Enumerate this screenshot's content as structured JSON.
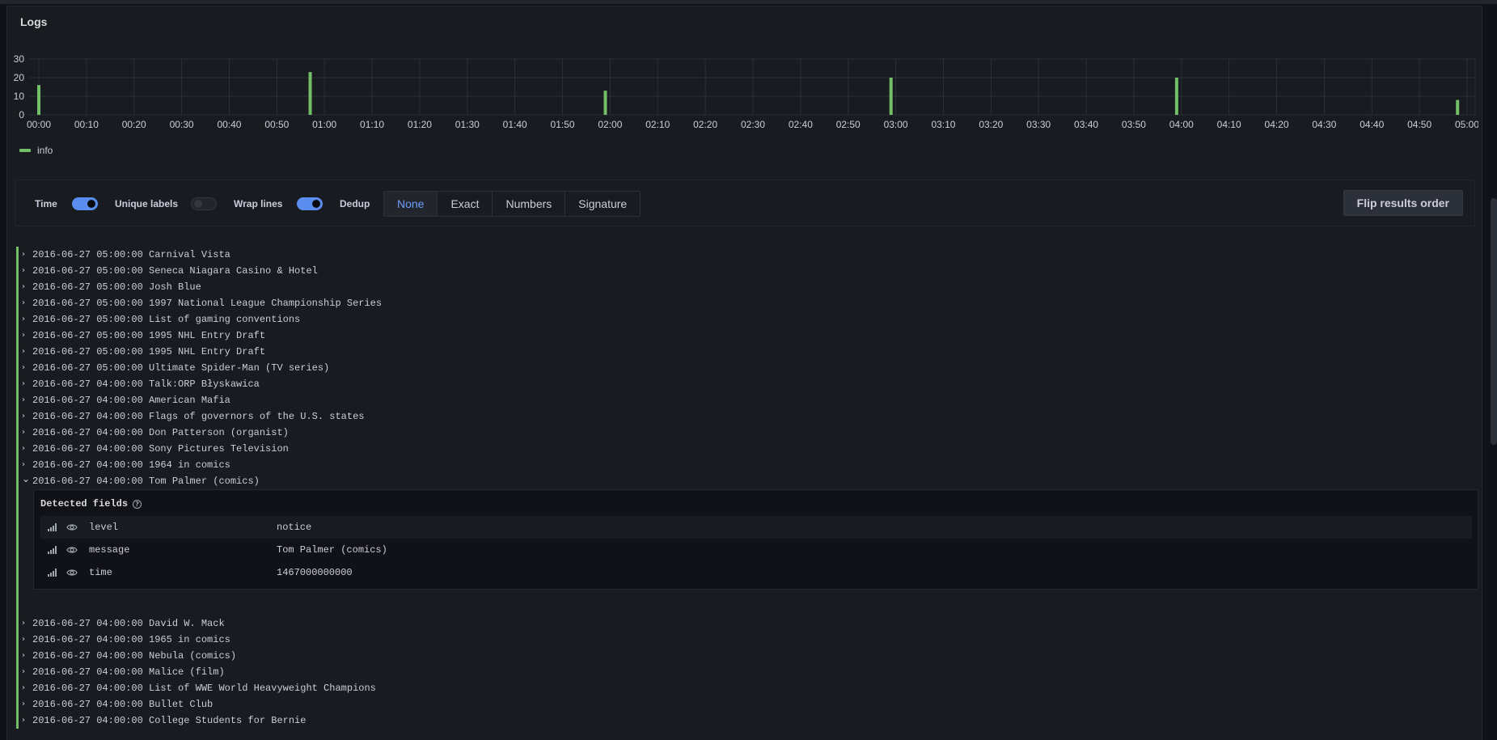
{
  "panel": {
    "title": "Logs"
  },
  "chart_data": {
    "type": "bar",
    "y_ticks": [
      "30",
      "20",
      "10",
      "0"
    ],
    "ylim": [
      0,
      30
    ],
    "x_ticks": [
      "00:00",
      "00:10",
      "00:20",
      "00:30",
      "00:40",
      "00:50",
      "01:00",
      "01:10",
      "01:20",
      "01:30",
      "01:40",
      "01:50",
      "02:00",
      "02:10",
      "02:20",
      "02:30",
      "02:40",
      "02:50",
      "03:00",
      "03:10",
      "03:20",
      "03:30",
      "03:40",
      "03:50",
      "04:00",
      "04:10",
      "04:20",
      "04:30",
      "04:40",
      "04:50",
      "05:00"
    ],
    "series": [
      {
        "name": "info",
        "points": [
          {
            "x": "00:00",
            "y": 16
          },
          {
            "x": "00:57",
            "y": 23
          },
          {
            "x": "01:59",
            "y": 13
          },
          {
            "x": "02:59",
            "y": 20
          },
          {
            "x": "03:59",
            "y": 20
          },
          {
            "x": "04:58",
            "y": 8
          }
        ]
      }
    ],
    "grid": true,
    "legend": "bottom-left",
    "color": "#73bf69"
  },
  "legend": {
    "label": "info"
  },
  "controls": {
    "time_label": "Time",
    "time_on": true,
    "unique_labels_label": "Unique labels",
    "unique_labels_on": false,
    "wrap_lines_label": "Wrap lines",
    "wrap_lines_on": true,
    "dedup_label": "Dedup",
    "dedup_options": [
      "None",
      "Exact",
      "Numbers",
      "Signature"
    ],
    "dedup_selected": "None",
    "flip_label": "Flip results order"
  },
  "logs_before": [
    {
      "ts": "2016-06-27 05:00:00",
      "msg": "Carnival Vista"
    },
    {
      "ts": "2016-06-27 05:00:00",
      "msg": "Seneca Niagara Casino & Hotel"
    },
    {
      "ts": "2016-06-27 05:00:00",
      "msg": "Josh Blue"
    },
    {
      "ts": "2016-06-27 05:00:00",
      "msg": "1997 National League Championship Series"
    },
    {
      "ts": "2016-06-27 05:00:00",
      "msg": "List of gaming conventions"
    },
    {
      "ts": "2016-06-27 05:00:00",
      "msg": "1995 NHL Entry Draft"
    },
    {
      "ts": "2016-06-27 05:00:00",
      "msg": "1995 NHL Entry Draft"
    },
    {
      "ts": "2016-06-27 05:00:00",
      "msg": "Ultimate Spider-Man (TV series)"
    },
    {
      "ts": "2016-06-27 04:00:00",
      "msg": "Talk:ORP Błyskawica"
    },
    {
      "ts": "2016-06-27 04:00:00",
      "msg": "American Mafia"
    },
    {
      "ts": "2016-06-27 04:00:00",
      "msg": "Flags of governors of the U.S. states"
    },
    {
      "ts": "2016-06-27 04:00:00",
      "msg": "Don Patterson (organist)"
    },
    {
      "ts": "2016-06-27 04:00:00",
      "msg": "Sony Pictures Television"
    },
    {
      "ts": "2016-06-27 04:00:00",
      "msg": "1964 in comics"
    }
  ],
  "expanded": {
    "ts": "2016-06-27 04:00:00",
    "msg": "Tom Palmer (comics)",
    "details_title": "Detected fields",
    "fields": [
      {
        "key": "level",
        "value": "notice"
      },
      {
        "key": "message",
        "value": "Tom Palmer (comics)"
      },
      {
        "key": "time",
        "value": "1467000000000"
      }
    ]
  },
  "logs_after": [
    {
      "ts": "2016-06-27 04:00:00",
      "msg": "David W. Mack"
    },
    {
      "ts": "2016-06-27 04:00:00",
      "msg": "1965 in comics"
    },
    {
      "ts": "2016-06-27 04:00:00",
      "msg": "Nebula (comics)"
    },
    {
      "ts": "2016-06-27 04:00:00",
      "msg": "Malice (film)"
    },
    {
      "ts": "2016-06-27 04:00:00",
      "msg": "List of WWE World Heavyweight Champions"
    },
    {
      "ts": "2016-06-27 04:00:00",
      "msg": "Bullet Club"
    },
    {
      "ts": "2016-06-27 04:00:00",
      "msg": "College Students for Bernie"
    }
  ]
}
